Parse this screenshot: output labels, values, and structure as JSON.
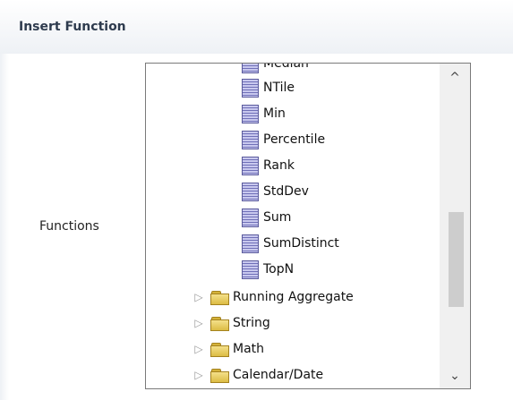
{
  "dialog": {
    "title": "Insert Function"
  },
  "form": {
    "functions_label": "Functions"
  },
  "tree": {
    "partial_item": "Median",
    "leaf_items": [
      "NTile",
      "Min",
      "Percentile",
      "Rank",
      "StdDev",
      "Sum",
      "SumDistinct",
      "TopN"
    ],
    "folders": [
      "Running Aggregate",
      "String",
      "Math",
      "Calendar/Date"
    ]
  },
  "icons": {
    "leaf": "function-icon",
    "folder": "folder-icon",
    "expand": "chevron-right-icon"
  },
  "scrollbar": {
    "up_arrow": "^",
    "down_arrow": "⌄"
  },
  "colors": {
    "title": "#2e3b4e",
    "header_gradient_end": "#eef1f5",
    "list_border": "#7a7a7a",
    "scroll_thumb": "#cdcdcd"
  }
}
